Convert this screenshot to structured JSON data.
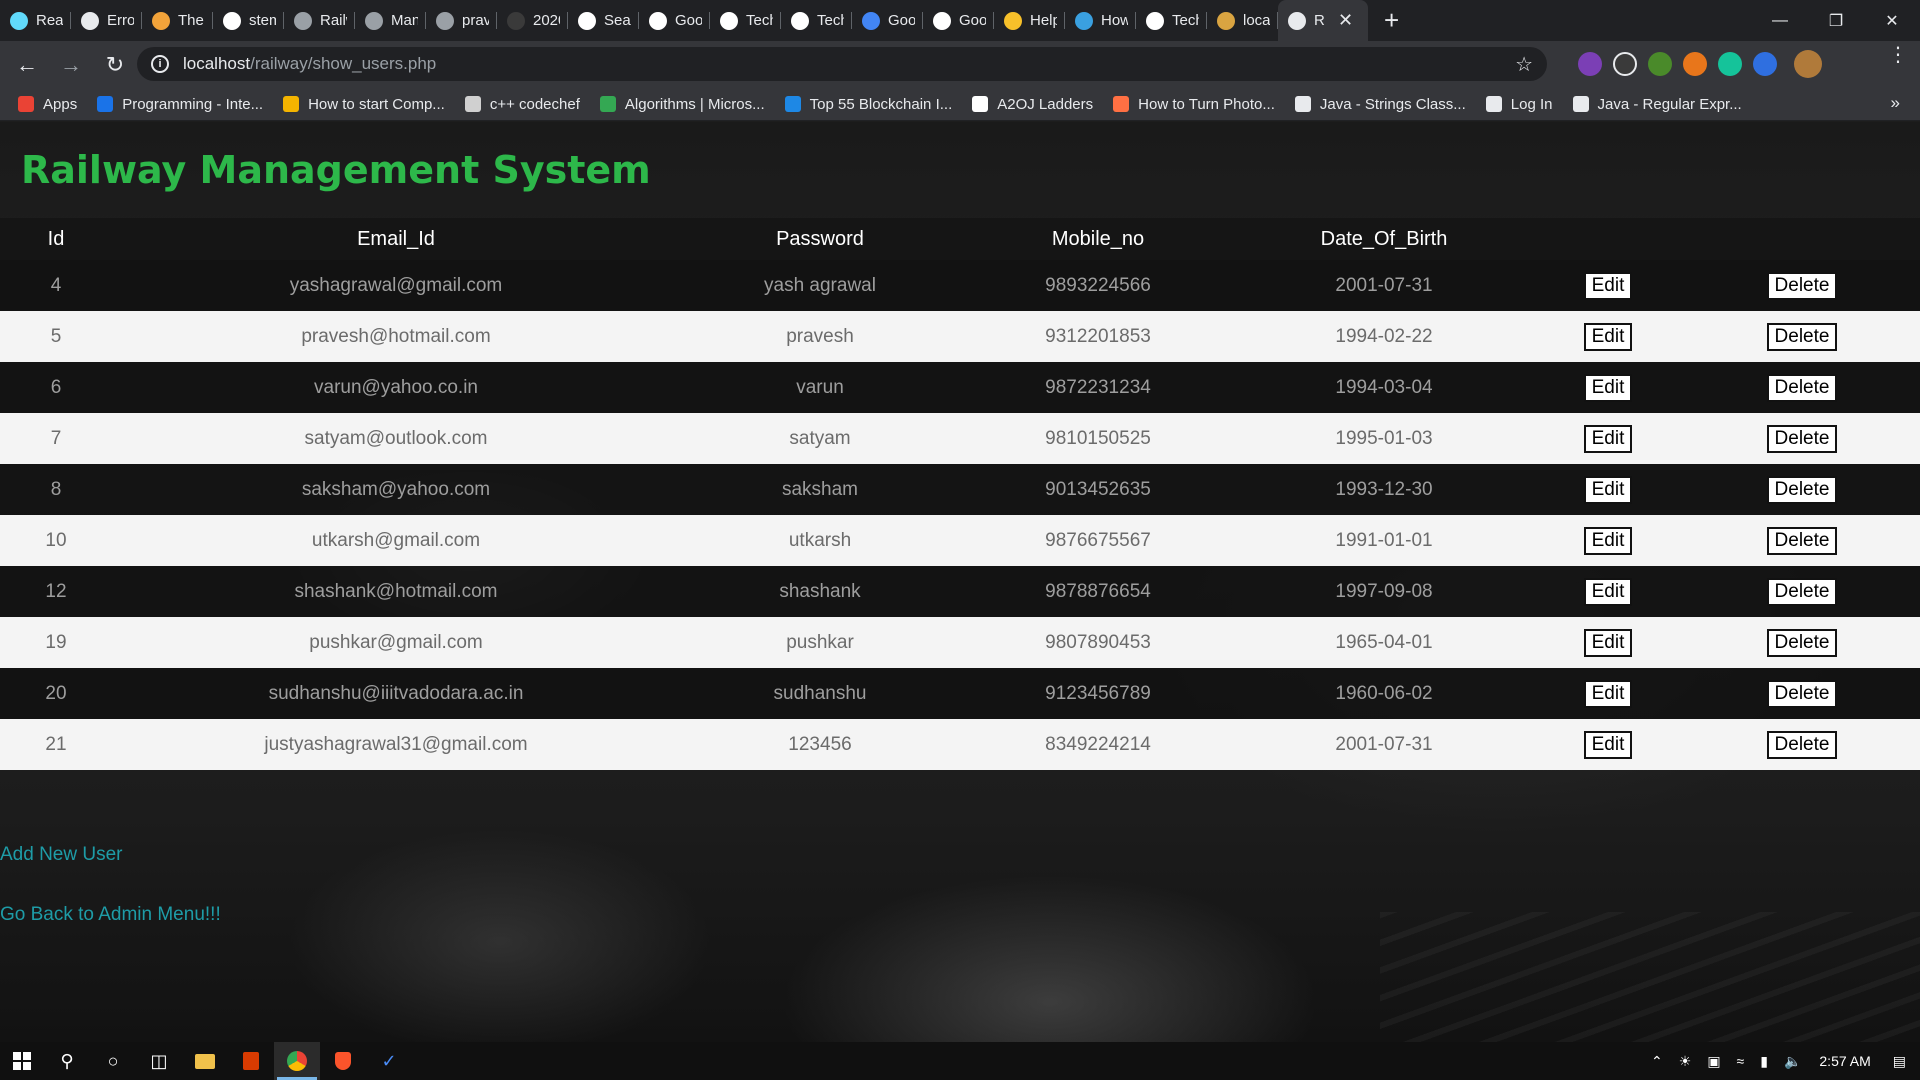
{
  "browser": {
    "tabs": [
      {
        "label": "React",
        "icon": "react-icon",
        "color": "#61dafb"
      },
      {
        "label": "Error",
        "icon": "globe-icon",
        "color": "#e8eaed"
      },
      {
        "label": "The T",
        "icon": "bookmark-icon",
        "color": "#f2a33a"
      },
      {
        "label": "stem",
        "icon": "google-icon",
        "color": "#ffffff"
      },
      {
        "label": "Railw",
        "icon": "github-icon",
        "color": "#9aa0a6"
      },
      {
        "label": "Mana",
        "icon": "github-icon",
        "color": "#9aa0a6"
      },
      {
        "label": "prave",
        "icon": "github-icon",
        "color": "#9aa0a6"
      },
      {
        "label": "2020",
        "icon": "leaf-icon",
        "color": "#3a3a3a"
      },
      {
        "label": "Seasc",
        "icon": "codeforces-icon",
        "color": "#ffffff"
      },
      {
        "label": "Goog",
        "icon": "codeforces-icon",
        "color": "#ffffff"
      },
      {
        "label": "Techn",
        "icon": "codeforces-icon",
        "color": "#ffffff"
      },
      {
        "label": "Techn",
        "icon": "codeforces-icon",
        "color": "#ffffff"
      },
      {
        "label": "Goog",
        "icon": "docs-icon",
        "color": "#4285f4"
      },
      {
        "label": "Goog",
        "icon": "medium-icon",
        "color": "#ffffff"
      },
      {
        "label": "Help:",
        "icon": "help-icon",
        "color": "#f7c02a"
      },
      {
        "label": "How",
        "icon": "snowflake-icon",
        "color": "#3aa0e0"
      },
      {
        "label": "Techn",
        "icon": "codeforces-icon",
        "color": "#ffffff"
      },
      {
        "label": "locall",
        "icon": "rail-icon",
        "color": "#d9a441"
      },
      {
        "label": "R",
        "icon": "globe-icon",
        "color": "#e8eaed",
        "active": true
      }
    ],
    "new_tab": "+",
    "address": {
      "host": "localhost",
      "path": "/railway/show_users.php"
    },
    "bookmarks": [
      {
        "label": "Apps",
        "color": "#ea4335"
      },
      {
        "label": "Programming - Inte...",
        "color": "#1a73e8"
      },
      {
        "label": "How to start Comp...",
        "color": "#f4b400"
      },
      {
        "label": "c++ codechef",
        "color": "#d0d0d0"
      },
      {
        "label": "Algorithms | Micros...",
        "color": "#34a853"
      },
      {
        "label": "Top 55 Blockchain I...",
        "color": "#1e88e5"
      },
      {
        "label": "A2OJ Ladders",
        "color": "#ffffff"
      },
      {
        "label": "How to Turn Photo...",
        "color": "#ff7043"
      },
      {
        "label": "Java - Strings Class...",
        "color": "#e8eaed"
      },
      {
        "label": "Log In",
        "color": "#e8eaed"
      },
      {
        "label": "Java - Regular Expr...",
        "color": "#e8eaed"
      }
    ]
  },
  "page": {
    "title": "Railway Management System",
    "columns": [
      "Id",
      "Email_Id",
      "Password",
      "Mobile_no",
      "Date_Of_Birth",
      "",
      ""
    ],
    "edit_label": "Edit",
    "delete_label": "Delete",
    "rows": [
      {
        "id": "4",
        "email": "yashagrawal@gmail.com",
        "password": "yash agrawal",
        "mobile": "9893224566",
        "dob": "2001-07-31"
      },
      {
        "id": "5",
        "email": "pravesh@hotmail.com",
        "password": "pravesh",
        "mobile": "9312201853",
        "dob": "1994-02-22"
      },
      {
        "id": "6",
        "email": "varun@yahoo.co.in",
        "password": "varun",
        "mobile": "9872231234",
        "dob": "1994-03-04"
      },
      {
        "id": "7",
        "email": "satyam@outlook.com",
        "password": "satyam",
        "mobile": "9810150525",
        "dob": "1995-01-03"
      },
      {
        "id": "8",
        "email": "saksham@yahoo.com",
        "password": "saksham",
        "mobile": "9013452635",
        "dob": "1993-12-30"
      },
      {
        "id": "10",
        "email": "utkarsh@gmail.com",
        "password": "utkarsh",
        "mobile": "9876675567",
        "dob": "1991-01-01"
      },
      {
        "id": "12",
        "email": "shashank@hotmail.com",
        "password": "shashank",
        "mobile": "9878876654",
        "dob": "1997-09-08"
      },
      {
        "id": "19",
        "email": "pushkar@gmail.com",
        "password": "pushkar",
        "mobile": "9807890453",
        "dob": "1965-04-01"
      },
      {
        "id": "20",
        "email": "sudhanshu@iiitvadodara.ac.in",
        "password": "sudhanshu",
        "mobile": "9123456789",
        "dob": "1960-06-02"
      },
      {
        "id": "21",
        "email": "justyashagrawal31@gmail.com",
        "password": "123456",
        "mobile": "8349224214",
        "dob": "2001-07-31"
      }
    ],
    "links": {
      "add_user": "Add New User",
      "back": "Go Back to Admin Menu!!!"
    },
    "colors": {
      "title": "#2db84a",
      "link": "#1e9ca7"
    }
  },
  "taskbar": {
    "clock": "2:57 AM"
  }
}
